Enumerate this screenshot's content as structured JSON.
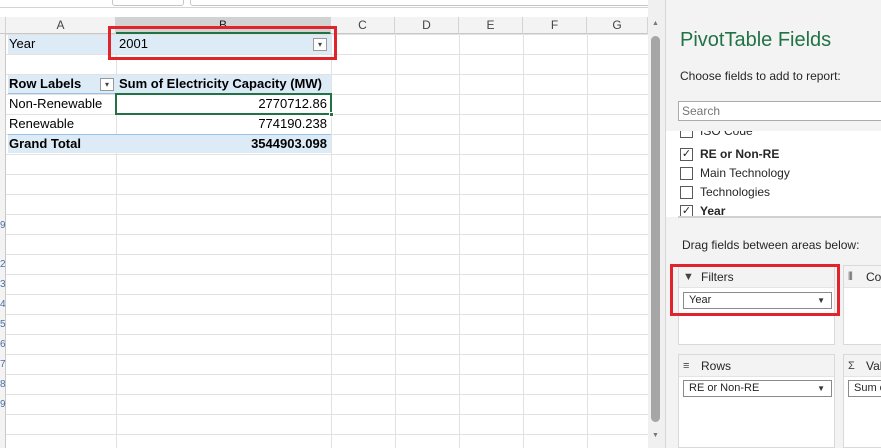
{
  "sheet": {
    "columns": [
      "A",
      "B",
      "C",
      "D",
      "E",
      "F",
      "G"
    ],
    "row_numbers": [
      "9",
      "2",
      "3",
      "4",
      "5",
      "6",
      "7",
      "8",
      "9"
    ],
    "filter": {
      "label": "Year",
      "value": "2001",
      "dropdown_glyph": "▾"
    },
    "pivot": {
      "header": {
        "row_labels": "Row Labels",
        "values": "Sum of Electricity Capacity (MW)",
        "dropdown_glyph": "▾"
      },
      "rows": [
        {
          "label": "Non-Renewable",
          "value": "2770712.86"
        },
        {
          "label": "Renewable",
          "value": "774190.238"
        }
      ],
      "total": {
        "label": "Grand Total",
        "value": "3544903.098"
      }
    }
  },
  "pane": {
    "title": "PivotTable Fields",
    "subtitle": "Choose fields to add to report:",
    "search_placeholder": "Search",
    "fields": [
      {
        "label": "ISO Code",
        "checked": false,
        "bold": false,
        "mark": ""
      },
      {
        "label": "RE or Non-RE",
        "checked": true,
        "bold": true,
        "mark": "✓"
      },
      {
        "label": "Main Technology",
        "checked": false,
        "bold": false,
        "mark": ""
      },
      {
        "label": "Technologies",
        "checked": false,
        "bold": false,
        "mark": ""
      },
      {
        "label": "Year",
        "checked": true,
        "bold": true,
        "mark": "✓"
      }
    ],
    "drag_label": "Drag fields between areas below:",
    "areas": {
      "filters": {
        "title": "Filters",
        "icon": "▼",
        "item": "Year",
        "caret": "▼"
      },
      "columns": {
        "title": "Co",
        "icon": "⦀"
      },
      "rows": {
        "title": "Rows",
        "icon": "≡",
        "item": "RE or Non-RE",
        "caret": "▼"
      },
      "values": {
        "title": "Val",
        "icon": "Σ",
        "item": "Sum c"
      }
    }
  },
  "colors": {
    "accent": "#217346",
    "highlight": "#e0242b",
    "pivot_band": "#ddebf7"
  }
}
